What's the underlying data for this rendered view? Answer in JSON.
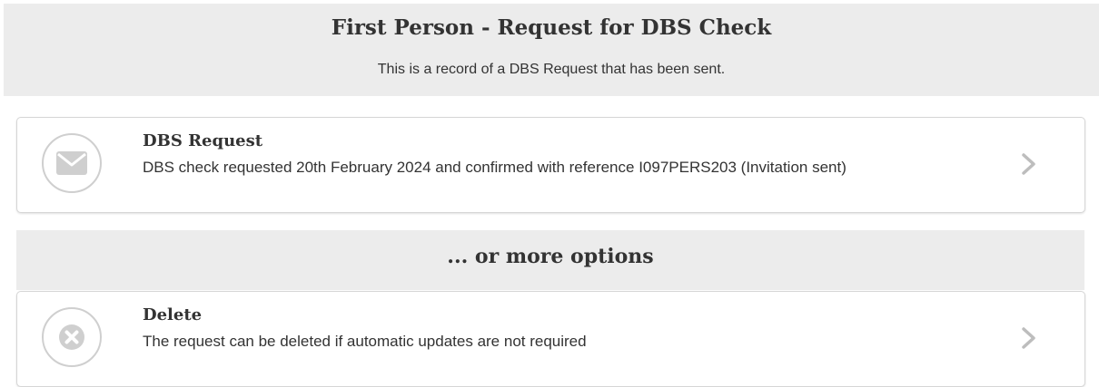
{
  "header": {
    "title": "First Person - Request for DBS Check",
    "subtitle": "This is a record of a DBS Request that has been sent."
  },
  "request_card": {
    "icon": "envelope-icon",
    "title": "DBS Request",
    "description": "DBS check requested 20th February 2024 and confirmed with reference I097PERS203 (Invitation sent)"
  },
  "more_options": {
    "title": "... or more options"
  },
  "delete_card": {
    "icon": "cross-icon",
    "title": "Delete",
    "description": "The request can be deleted if automatic updates are not required"
  },
  "colors": {
    "header_bg": "#ececec",
    "icon_grey": "#cfcfcf",
    "text": "#333333"
  }
}
